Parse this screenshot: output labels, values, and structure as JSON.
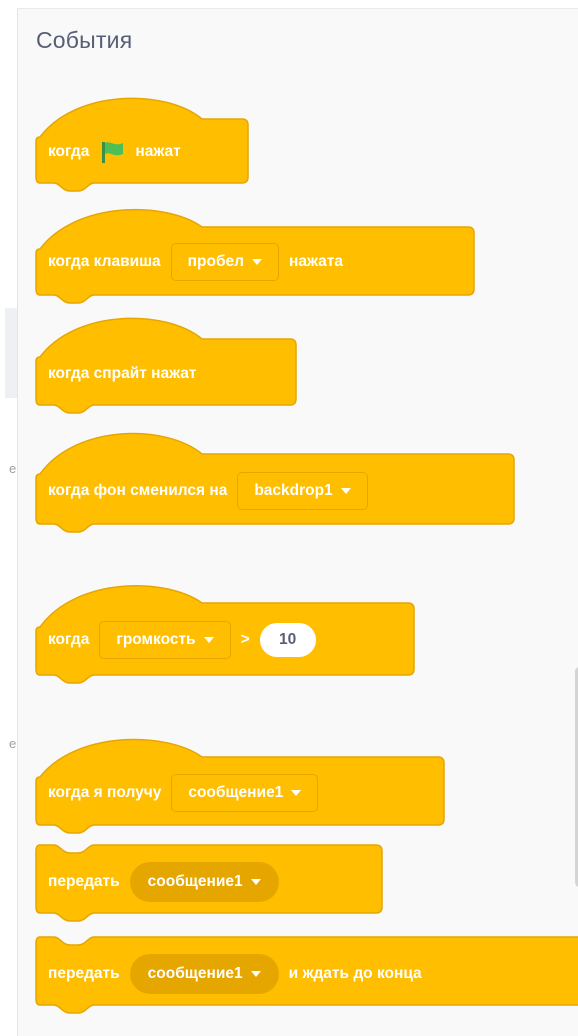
{
  "category": {
    "title": "События"
  },
  "edge_chars": [
    "e",
    "e"
  ],
  "colors": {
    "block_fill": "#FFBF00",
    "block_border": "#E6A600",
    "dropdown_round_fill": "#E6A600",
    "flag_green": "#4CBF56",
    "title_text": "#575E75"
  },
  "blocks": {
    "flag_clicked": {
      "prefix": "когда",
      "icon": "green-flag-icon",
      "suffix": "нажат"
    },
    "key_pressed": {
      "prefix": "когда клавиша",
      "dropdown": "пробел",
      "suffix": "нажата"
    },
    "sprite_clicked": {
      "label": "когда спрайт нажат"
    },
    "backdrop_switch": {
      "prefix": "когда фон сменился на",
      "dropdown": "backdrop1"
    },
    "greater_than": {
      "prefix": "когда",
      "dropdown": "громкость",
      "operator": ">",
      "value": "10"
    },
    "receive": {
      "prefix": "когда я получу",
      "dropdown": "сообщение1"
    },
    "broadcast": {
      "prefix": "передать",
      "dropdown": "сообщение1"
    },
    "broadcast_wait": {
      "prefix": "передать",
      "dropdown": "сообщение1",
      "suffix": "и ждать до конца"
    }
  }
}
